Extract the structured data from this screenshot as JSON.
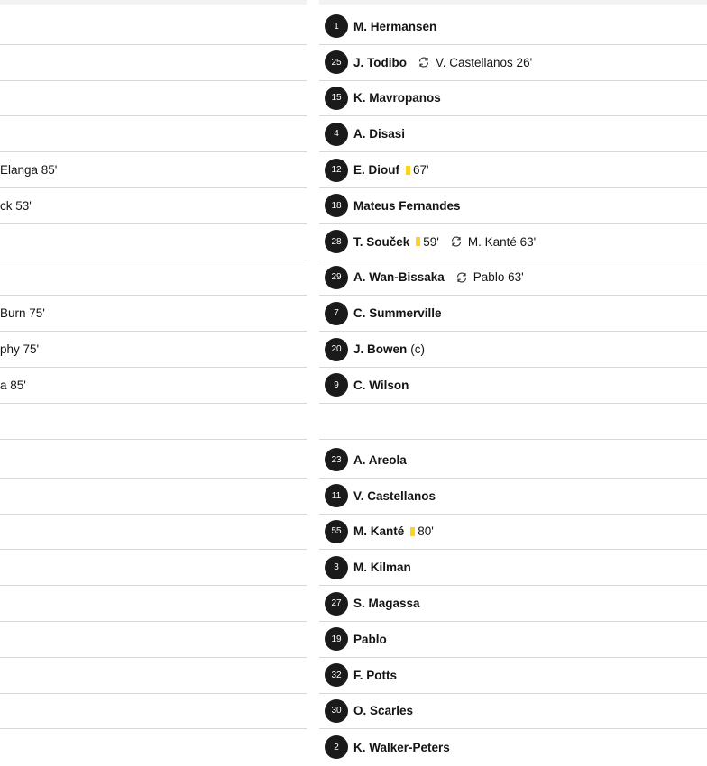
{
  "left_partial": {
    "starting_rows": [
      "",
      "",
      "",
      "",
      "Elanga 85'",
      "ck 53'",
      "",
      "",
      " Burn 75'",
      "phy 75'",
      "a 85'"
    ],
    "sub_rows": [
      "",
      "",
      "",
      "",
      "",
      "",
      "",
      "",
      ""
    ]
  },
  "starting": [
    {
      "number": "1",
      "name": "M. Hermansen",
      "extra": "",
      "card": "",
      "sub": ""
    },
    {
      "number": "25",
      "name": "J. Todibo",
      "extra": "",
      "card": "",
      "sub": "V. Castellanos 26'"
    },
    {
      "number": "15",
      "name": "K. Mavropanos",
      "extra": "",
      "card": "",
      "sub": ""
    },
    {
      "number": "4",
      "name": "A. Disasi",
      "extra": "",
      "card": "",
      "sub": ""
    },
    {
      "number": "12",
      "name": "E. Diouf",
      "extra": "",
      "card": "67'",
      "sub": ""
    },
    {
      "number": "18",
      "name": "Mateus Fernandes",
      "extra": "",
      "card": "",
      "sub": ""
    },
    {
      "number": "28",
      "name": "T. Souček",
      "extra": "",
      "card": "59'",
      "sub": "M. Kanté 63'"
    },
    {
      "number": "29",
      "name": "A. Wan-Bissaka",
      "extra": "",
      "card": "",
      "sub": "Pablo 63'"
    },
    {
      "number": "7",
      "name": "C. Summerville",
      "extra": "",
      "card": "",
      "sub": ""
    },
    {
      "number": "20",
      "name": "J. Bowen",
      "extra": "(c)",
      "card": "",
      "sub": ""
    },
    {
      "number": "9",
      "name": "C. Wilson",
      "extra": "",
      "card": "",
      "sub": ""
    }
  ],
  "subs": [
    {
      "number": "23",
      "name": "A. Areola",
      "card": ""
    },
    {
      "number": "11",
      "name": "V. Castellanos",
      "card": ""
    },
    {
      "number": "55",
      "name": "M. Kanté",
      "card": "80'"
    },
    {
      "number": "3",
      "name": "M. Kilman",
      "card": ""
    },
    {
      "number": "27",
      "name": "S. Magassa",
      "card": ""
    },
    {
      "number": "19",
      "name": "Pablo",
      "card": ""
    },
    {
      "number": "32",
      "name": "F. Potts",
      "card": ""
    },
    {
      "number": "30",
      "name": "O. Scarles",
      "card": ""
    },
    {
      "number": "2",
      "name": "K. Walker-Peters",
      "card": ""
    }
  ],
  "colors": {
    "card": "#ffd21f",
    "badge": "#1a1a1a",
    "divider": "#d8d8d8"
  },
  "icons": {
    "substitution": "substitution-icon",
    "yellow_card": "yellow-card-icon"
  }
}
